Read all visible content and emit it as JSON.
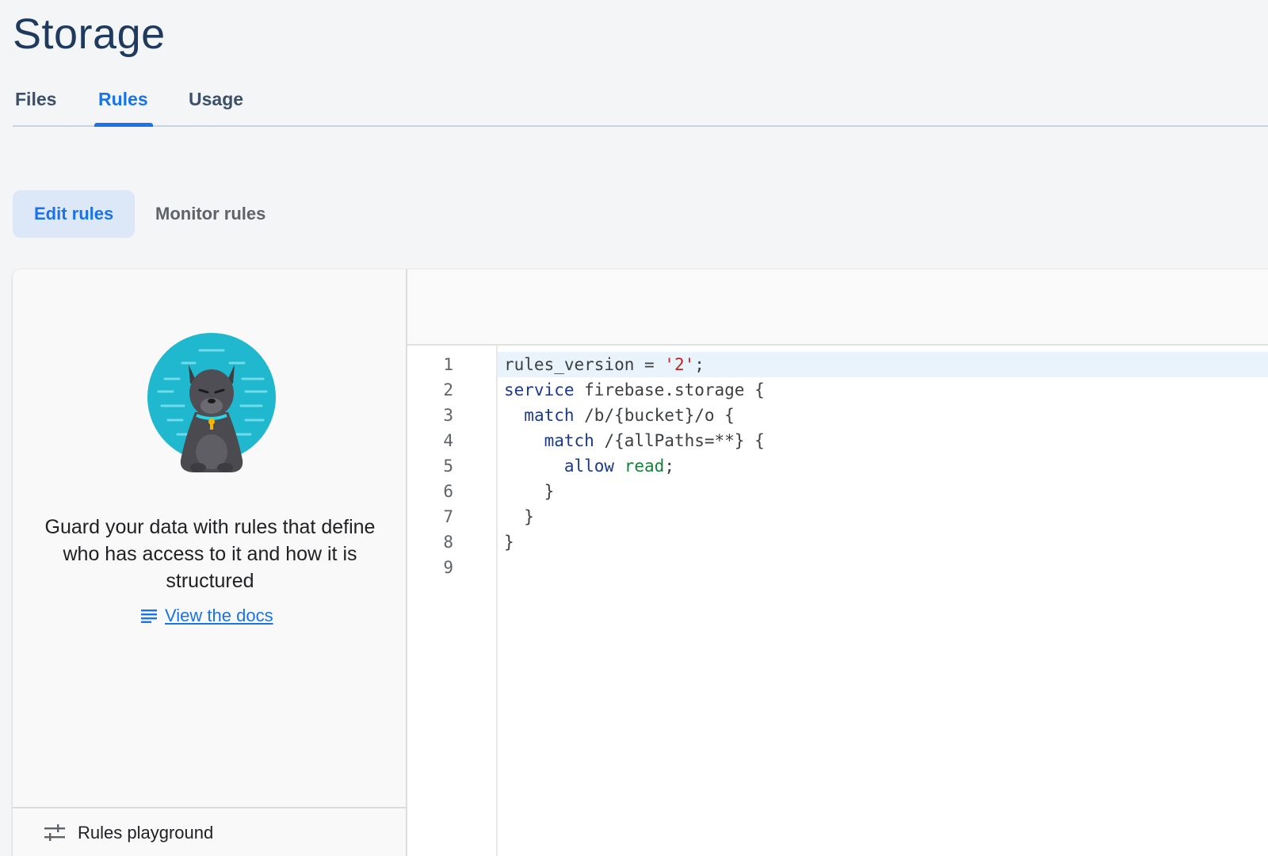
{
  "page": {
    "title": "Storage"
  },
  "tabs": [
    {
      "label": "Files",
      "active": false
    },
    {
      "label": "Rules",
      "active": true
    },
    {
      "label": "Usage",
      "active": false
    }
  ],
  "subtabs": [
    {
      "label": "Edit rules",
      "active": true
    },
    {
      "label": "Monitor rules",
      "active": false
    }
  ],
  "left_panel": {
    "description": "Guard your data with rules that define who has access to it and how it is structured",
    "docs_link": "View the docs",
    "playground_label": "Rules playground"
  },
  "editor": {
    "line_numbers": [
      "1",
      "2",
      "3",
      "4",
      "5",
      "6",
      "7",
      "8",
      "9"
    ],
    "lines": [
      [
        {
          "t": "rules_version = "
        },
        {
          "t": "'2'",
          "c": "str"
        },
        {
          "t": ";"
        }
      ],
      [
        {
          "t": "service",
          "c": "kw"
        },
        {
          "t": " firebase.storage {"
        }
      ],
      [
        {
          "t": "  "
        },
        {
          "t": "match",
          "c": "kw"
        },
        {
          "t": " /b/{bucket}/o {"
        }
      ],
      [
        {
          "t": "    "
        },
        {
          "t": "match",
          "c": "kw"
        },
        {
          "t": " /{allPaths=**} {"
        }
      ],
      [
        {
          "t": "      "
        },
        {
          "t": "allow",
          "c": "kw"
        },
        {
          "t": " "
        },
        {
          "t": "read",
          "c": "grn"
        },
        {
          "t": ";"
        }
      ],
      [
        {
          "t": "    }"
        }
      ],
      [
        {
          "t": "  }"
        }
      ],
      [
        {
          "t": "}"
        }
      ],
      [
        {
          "t": ""
        }
      ]
    ],
    "highlighted_line": 1
  },
  "colors": {
    "accent": "#1a73e8",
    "title": "#1e3a5f",
    "illustration_circle": "#1fb8cf"
  }
}
